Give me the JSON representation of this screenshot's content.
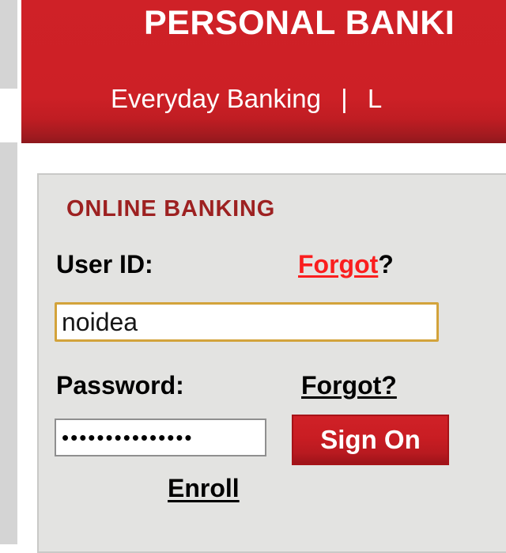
{
  "masthead": {
    "title": "PERSONAL BANKI",
    "nav": {
      "items": [
        {
          "label": "Everyday Banking"
        },
        {
          "label": "L"
        }
      ],
      "separator": "|"
    }
  },
  "login_panel": {
    "heading": "ONLINE BANKING",
    "user_id": {
      "label": "User ID:",
      "value": "noidea",
      "placeholder": "",
      "forgot_word": "Forgot",
      "forgot_question": "?"
    },
    "password": {
      "label": "Password:",
      "value": "•••••••••••••••",
      "masked_character_count": 15,
      "placeholder": "",
      "forgot_label": "Forgot?"
    },
    "sign_on_label": "Sign On",
    "enroll_label": "Enroll"
  },
  "colors": {
    "brand_red": "#cd2026",
    "brand_red_dark": "#8c171c",
    "heading_maroon": "#9d2121",
    "link_red": "#fa1e1e",
    "panel_bg": "#e3e3e1",
    "panel_border": "#c9c9c7",
    "input_focus_gold": "#d3a33b",
    "input_border_gray": "#8f8f8f",
    "gutter_gray": "#d4d4d4",
    "button_red": "#c4191f",
    "text_black": "#000000",
    "text_white": "#ffffff"
  }
}
